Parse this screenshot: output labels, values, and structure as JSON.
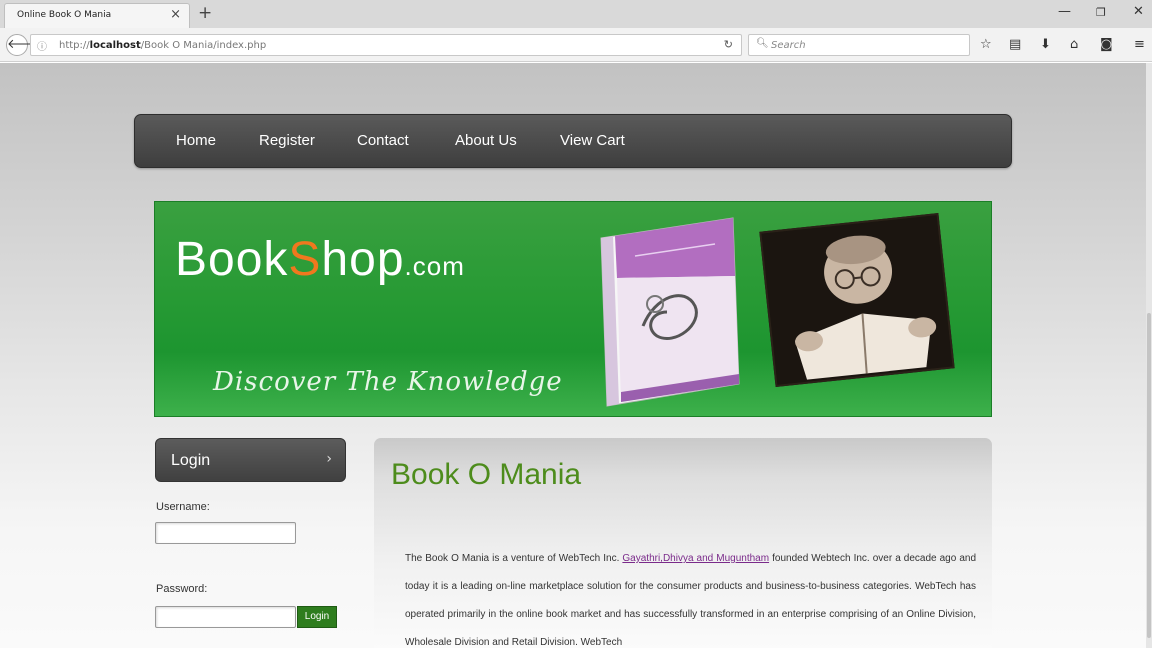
{
  "browser": {
    "tab_title": "Online Book O Mania",
    "url_prefix": "http://",
    "url_host": "localhost",
    "url_path": "/Book O Mania/index.php",
    "search_placeholder": "Search"
  },
  "nav": {
    "items": [
      {
        "label": "Home"
      },
      {
        "label": "Register"
      },
      {
        "label": "Contact"
      },
      {
        "label": "About Us"
      },
      {
        "label": "View Cart"
      }
    ]
  },
  "banner": {
    "logo_prefix": "Book",
    "logo_s": "S",
    "logo_suffix": "hop",
    "logo_domain": ".com",
    "tagline": "Discover The Knowledge"
  },
  "login": {
    "title": "Login",
    "chevron": "›",
    "username_label": "Username:",
    "password_label": "Password:",
    "button_label": "Login"
  },
  "content": {
    "title": "Book O Mania",
    "intro": "The Book O Mania is a venture of WebTech Inc. ",
    "founders_link": "Gayathri,Dhivya and Muguntham",
    "rest": " founded Webtech Inc. over a decade ago and today it is a leading on-line marketplace solution for the consumer products and business-to-business categories. WebTech has operated primarily in the online book market and has successfully transformed in an enterprise comprising of an Online Division, Wholesale Division and Retail Division. WebTech"
  },
  "colors": {
    "banner_green": "#279a34",
    "logo_orange": "#f0781e",
    "title_green": "#4d8c1c",
    "link_purple": "#7a2a8a",
    "nav_dark": "#4a4a4a"
  },
  "icons": {
    "back": "back-arrow-icon",
    "info": "info-icon",
    "reload": "reload-icon",
    "search": "search-icon",
    "bookmark": "star-icon",
    "library": "library-icon",
    "download": "download-icon",
    "home": "home-icon",
    "pocket": "pocket-icon",
    "menu": "hamburger-menu-icon"
  }
}
